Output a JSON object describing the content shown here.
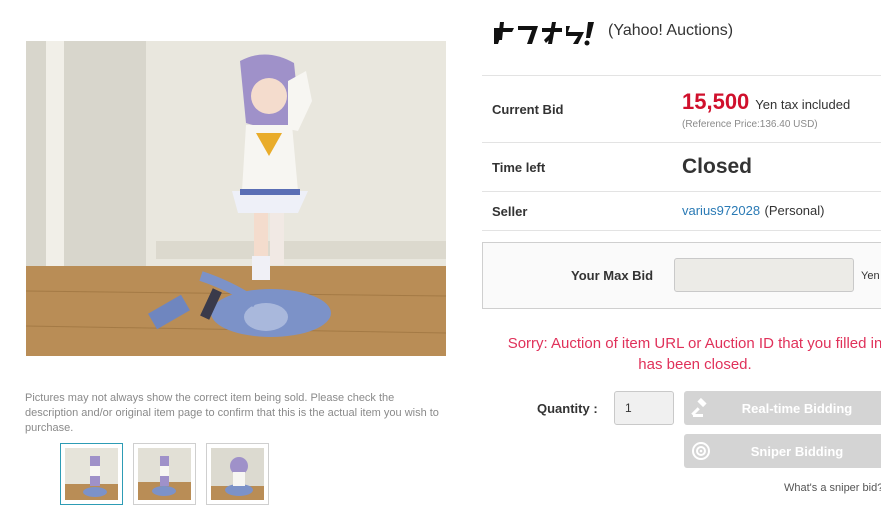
{
  "gallery": {
    "main_image_alt": "Figure photo",
    "disclaimer": "Pictures may not always show the correct item being sold. Please check the description and/or original item page to confirm that this is the actual item you wish to purchase.",
    "thumbnails": [
      {
        "alt": "thumbnail 1",
        "active": true
      },
      {
        "alt": "thumbnail 2",
        "active": false
      },
      {
        "alt": "thumbnail 3",
        "active": false
      }
    ]
  },
  "site": {
    "logo_text": "ヤフオク!",
    "name": "(Yahoo! Auctions)"
  },
  "item": {
    "current_bid_label": "Current Bid",
    "price": "15,500",
    "price_unit": "Yen tax included",
    "reference_price": "(Reference Price:136.40 USD)",
    "time_left_label": "Time left",
    "time_left_value": "Closed",
    "seller_label": "Seller",
    "seller_name": "varius972028",
    "seller_type": "(Personal)"
  },
  "bid_form": {
    "max_bid_label": "Your Max Bid",
    "max_bid_value": "",
    "max_bid_unit": "Yen",
    "error_message": "Sorry: Auction of item URL or Auction ID that you filled in has been closed.",
    "quantity_label": "Quantity :",
    "quantity_value": "1",
    "realtime_button": "Real-time Bidding",
    "sniper_button": "Sniper Bidding",
    "sniper_help": "What's a sniper bid?"
  },
  "colors": {
    "price_red": "#d0102c",
    "error_pink": "#e0315a",
    "link_blue": "#2a7ab5",
    "button_disabled": "#d4d4d4"
  },
  "icons": {
    "realtime": "gavel-icon",
    "sniper": "target-icon"
  }
}
